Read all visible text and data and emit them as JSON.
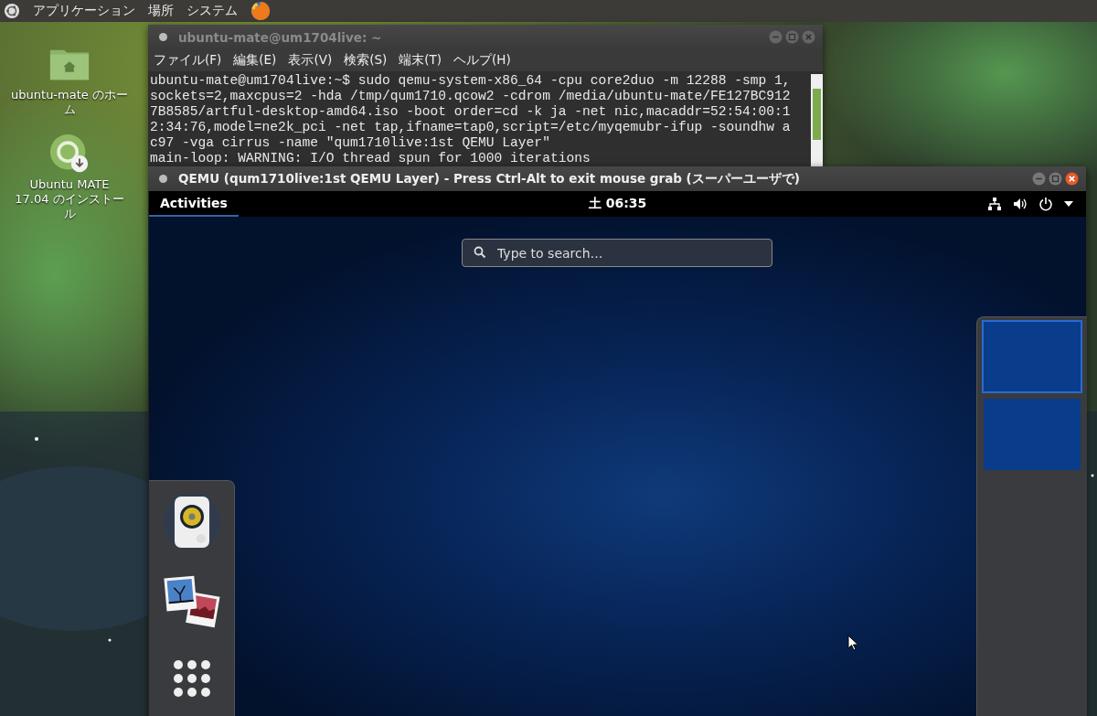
{
  "top_panel": {
    "menus": [
      "アプリケーション",
      "場所",
      "システム"
    ]
  },
  "desktop_icons": [
    {
      "kind": "folder",
      "label": "ubuntu-mate のホーム"
    },
    {
      "kind": "installer",
      "label": "Ubuntu MATE 17.04 のインストール"
    }
  ],
  "terminal": {
    "title": "ubuntu-mate@um1704live: ~",
    "menu": [
      "ファイル(F)",
      "編集(E)",
      "表示(V)",
      "検索(S)",
      "端末(T)",
      "ヘルプ(H)"
    ],
    "lines": [
      "ubuntu-mate@um1704live:~$ sudo qemu-system-x86_64 -cpu core2duo -m 12288 -smp 1,",
      "sockets=2,maxcpus=2 -hda /tmp/qum1710.qcow2 -cdrom /media/ubuntu-mate/FE127BC912",
      "7B8585/artful-desktop-amd64.iso -boot order=cd -k ja -net nic,macaddr=52:54:00:1",
      "2:34:76,model=ne2k_pci -net tap,ifname=tap0,script=/etc/myqemubr-ifup -soundhw a",
      "c97 -vga cirrus -name \"qum1710live:1st QEMU Layer\"",
      "main-loop: WARNING: I/O thread spun for 1000 iterations"
    ]
  },
  "qemu": {
    "title": "QEMU (qum1710live:1st QEMU Layer) - Press Ctrl-Alt to exit mouse grab (スーパーユーザで)",
    "guest": {
      "activities": {
        "label": "Activities",
        "selected": true
      },
      "clock": "土 06:35",
      "search": {
        "placeholder": "Type to search…"
      },
      "dash": [
        {
          "kind": "speaker"
        },
        {
          "kind": "photos"
        },
        {
          "kind": "app-grid"
        }
      ],
      "workspaces": [
        {
          "selected": true
        },
        {
          "selected": false
        }
      ]
    }
  }
}
